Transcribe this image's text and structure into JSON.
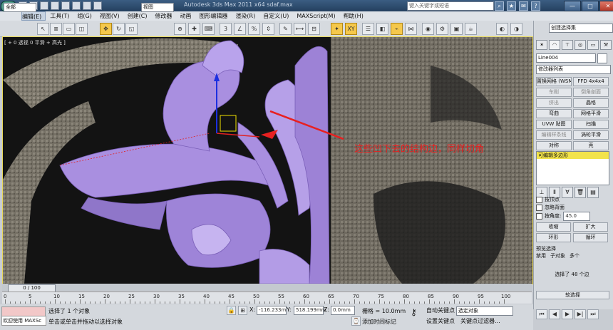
{
  "window": {
    "title": "Autodesk 3ds Max   2011 x64     sdaf.max",
    "search_placeholder": "键入关键字或短语",
    "minimize": "—",
    "maximize": "□",
    "close": "✕"
  },
  "menu": [
    "编辑(E)",
    "工具(T)",
    "组(G)",
    "视图(V)",
    "创建(C)",
    "修改器",
    "动画",
    "图形编辑器",
    "渲染(R)",
    "自定义(U)",
    "MAXScript(M)",
    "帮助(H)"
  ],
  "toolbar": {
    "selection_filter": "全部",
    "reference_coord": "视图",
    "create_selection_set": "创建选择集"
  },
  "viewport": {
    "label": "[ + 0 透视 0 平滑 + 高光 ]",
    "annotation": "这些凹下去的结构边，同样切角",
    "annotation_color": "#e82020"
  },
  "command_panel": {
    "object_name": "Line004",
    "modifier_list": "修改器列表",
    "modifiers": [
      "置换网格 (WSM)",
      "FFD 4x4x4",
      "车削",
      "倒角剖面",
      "挤出",
      "晶格",
      "弯曲",
      "网格平滑",
      "UVW 贴图",
      "扫描",
      "编辑样条线",
      "涡轮平滑",
      "对称",
      "壳"
    ],
    "disabled_modifiers": [
      2,
      3,
      4,
      10
    ],
    "stack_item": "可编辑多边形",
    "selection": {
      "by_vertex": "按顶点",
      "ignore_backfacing": "忽略背面",
      "by_angle": "按角度:",
      "angle_value": "45.0",
      "shrink": "收缩",
      "grow": "扩大",
      "ring": "环形",
      "loop": "循环",
      "preview_title": "预览选择",
      "preview_options": [
        "禁用",
        "子对象",
        "多个"
      ],
      "status": "选择了 48 个边",
      "soft_selection": "软选择"
    }
  },
  "timeline": {
    "slider": "0 / 100",
    "ticks": [
      "0",
      "5",
      "10",
      "15",
      "20",
      "25",
      "30",
      "35",
      "40",
      "45",
      "50",
      "55",
      "60",
      "65",
      "70",
      "75",
      "80",
      "85",
      "90",
      "95",
      "100"
    ]
  },
  "status_bar": {
    "welcome": "欢迎使用 MAXSc",
    "message": "选择了 1 个对象",
    "prompt": "单击或单击并拖动以选择对象",
    "x_label": "X:",
    "x_value": "-116.233m",
    "y_label": "Y:",
    "y_value": "518.199mm",
    "z_label": "Z:",
    "z_value": "0.0mm",
    "grid": "栅格 = 10.0mm",
    "auto_key": "自动关键点",
    "set_key": "设置关键点",
    "selected_object": "选定对象",
    "add_time_tag": "添加时间标记",
    "key_filters": "关键点过滤器..."
  }
}
